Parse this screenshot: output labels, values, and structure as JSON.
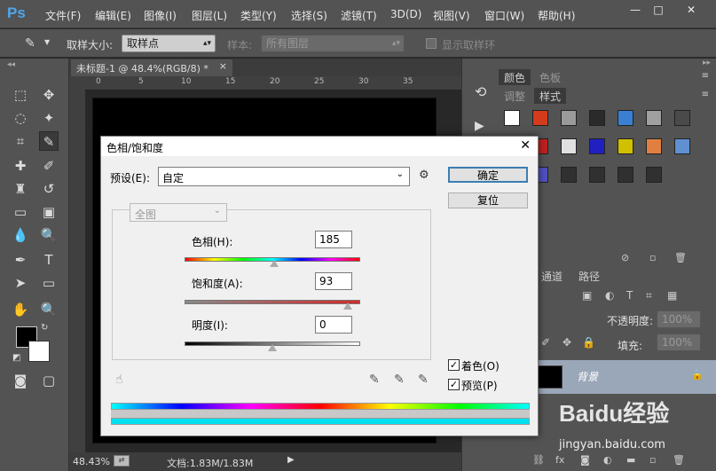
{
  "app": {
    "logo": "Ps"
  },
  "menu": [
    "文件(F)",
    "编辑(E)",
    "图像(I)",
    "图层(L)",
    "类型(Y)",
    "选择(S)",
    "滤镜(T)",
    "3D(D)",
    "视图(V)",
    "窗口(W)",
    "帮助(H)"
  ],
  "window_controls": {
    "minimize": "—",
    "maximize": "□",
    "close": "✕"
  },
  "options": {
    "sample_size_label": "取样大小:",
    "sample_size_value": "取样点",
    "sample_label": "样本:",
    "sample_value": "所有图层",
    "show_ring_label": "显示取样环"
  },
  "document": {
    "tab_title": "未标题-1 @ 48.4%(RGB/8) *",
    "close": "×",
    "ruler_ticks": [
      "0",
      "5",
      "10",
      "15",
      "20",
      "25",
      "30",
      "35"
    ]
  },
  "status": {
    "zoom": "48.43%",
    "doc_info": "文档:1.83M/1.83M"
  },
  "panels": {
    "tabs_top": [
      "颜色",
      "色板"
    ],
    "tabs_mid": [
      "调整",
      "样式"
    ],
    "tabs_layers": [
      "通道",
      "路径"
    ],
    "opacity_label": "不透明度:",
    "opacity_value": "100%",
    "fill_label": "填充:",
    "fill_value": "100%",
    "layer_name": "背景",
    "style_colors": [
      "#ffffff",
      "#d43a1c",
      "#9a9a9a",
      "#2a2a2a",
      "#3a7fd1",
      "#a0a0a0",
      "#4a4a4a",
      "#f0e4c4",
      "#c02020",
      "#e0e0e0",
      "#2020c0",
      "#d0c000",
      "#e08040",
      "#6090d0",
      "#404040",
      "#5050c0",
      "#303030",
      "#303030",
      "#303030",
      "#303030"
    ]
  },
  "dialog": {
    "title": "色相/饱和度",
    "close": "✕",
    "preset_label": "预设(E):",
    "preset_value": "自定",
    "ok": "确定",
    "reset": "复位",
    "channel": "全图",
    "hue_label": "色相(H):",
    "hue_value": "185",
    "hue_position": 0.51,
    "saturation_label": "饱和度(A):",
    "saturation_value": "93",
    "saturation_position": 0.93,
    "lightness_label": "明度(I):",
    "lightness_value": "0",
    "lightness_position": 0.5,
    "colorize_label": "着色(O)",
    "preview_label": "预览(P)",
    "colorize_checked": "✓",
    "preview_checked": "✓"
  },
  "watermark": {
    "text": "Baidu经验",
    "url": "jingyan.baidu.com"
  }
}
